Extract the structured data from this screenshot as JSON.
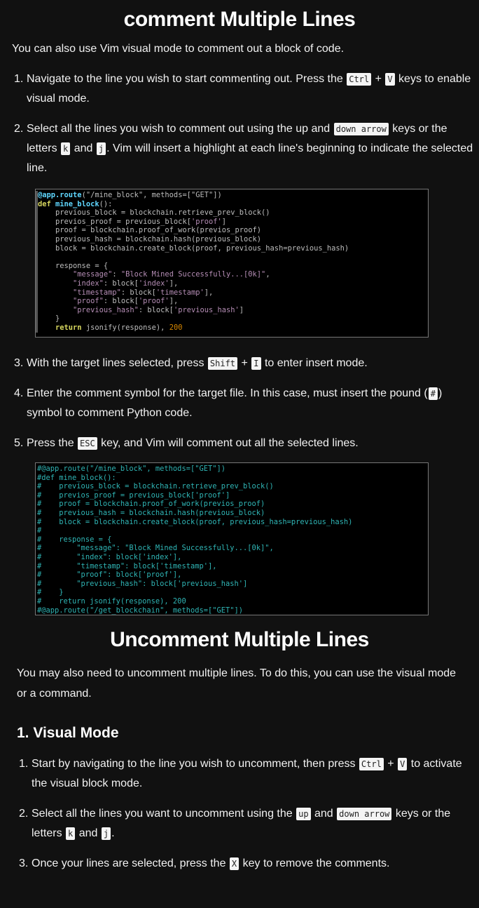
{
  "section1": {
    "title": "comment Multiple Lines",
    "intro": "You can also use Vim visual mode to comment out a block of code.",
    "steps_a": [
      [
        {
          "t": "Navigate to the line you wish to start commenting out. Press the "
        },
        {
          "k": "Ctrl"
        },
        {
          "t": " + "
        },
        {
          "k": "V"
        },
        {
          "t": " keys to enable visual mode."
        }
      ],
      [
        {
          "t": "Select all the lines you wish to comment out using the up and "
        },
        {
          "k": "down arrow"
        },
        {
          "t": " keys or the letters "
        },
        {
          "k": "k"
        },
        {
          "t": " and "
        },
        {
          "k": "j"
        },
        {
          "t": ". Vim will insert a highlight at each line's beginning to indicate the selected line."
        }
      ]
    ],
    "steps_b": [
      [
        {
          "t": "With the target lines selected, press "
        },
        {
          "k": "Shift"
        },
        {
          "t": " + "
        },
        {
          "k": "I"
        },
        {
          "t": " to enter insert mode."
        }
      ],
      [
        {
          "t": "Enter the comment symbol for the target file. In this case, must insert the pound ("
        },
        {
          "k": "#"
        },
        {
          "t": ") symbol to comment Python code."
        }
      ],
      [
        {
          "t": "Press the "
        },
        {
          "k": "ESC"
        },
        {
          "t": " key, and Vim will comment out all the selected lines."
        }
      ]
    ],
    "code_before": [
      [
        [
          "@app.route",
          "fn"
        ],
        [
          "(\"/mine_block\", methods=[\"GET\"])",
          "d"
        ]
      ],
      [
        [
          "def ",
          "kw"
        ],
        [
          "mine_block",
          "fn"
        ],
        [
          "():",
          "d"
        ]
      ],
      [
        [
          "    previous_block = blockchain.retrieve_prev_block()",
          "d"
        ]
      ],
      [
        [
          "    previos_proof = previous_block[",
          "d"
        ],
        [
          "'proof'",
          "st"
        ],
        [
          "]",
          "d"
        ]
      ],
      [
        [
          "    proof = blockchain.proof_of_work(previos_proof)",
          "d"
        ]
      ],
      [
        [
          "    previous_hash = blockchain.hash(previous_block)",
          "d"
        ]
      ],
      [
        [
          "    block = blockchain.create_block(proof, previous_hash=previous_hash)",
          "d"
        ]
      ],
      [
        [
          "",
          "d"
        ]
      ],
      [
        [
          "    response = {",
          "d"
        ]
      ],
      [
        [
          "        ",
          "d"
        ],
        [
          "\"message\"",
          "st"
        ],
        [
          ": ",
          "d"
        ],
        [
          "\"Block Mined Successfully...[0k]\"",
          "st"
        ],
        [
          ",",
          "d"
        ]
      ],
      [
        [
          "        ",
          "d"
        ],
        [
          "\"index\"",
          "st"
        ],
        [
          ": block[",
          "d"
        ],
        [
          "'index'",
          "st"
        ],
        [
          "],",
          "d"
        ]
      ],
      [
        [
          "        ",
          "d"
        ],
        [
          "\"timestamp\"",
          "st"
        ],
        [
          ": block[",
          "d"
        ],
        [
          "'timestamp'",
          "st"
        ],
        [
          "],",
          "d"
        ]
      ],
      [
        [
          "        ",
          "d"
        ],
        [
          "\"proof\"",
          "st"
        ],
        [
          ": block[",
          "d"
        ],
        [
          "'proof'",
          "st"
        ],
        [
          "],",
          "d"
        ]
      ],
      [
        [
          "        ",
          "d"
        ],
        [
          "\"previous_hash\"",
          "st"
        ],
        [
          ": block[",
          "d"
        ],
        [
          "'previous_hash'",
          "st"
        ],
        [
          "]",
          "d"
        ]
      ],
      [
        [
          "    }",
          "d"
        ]
      ],
      [
        [
          "    ",
          "d"
        ],
        [
          "return ",
          "kw"
        ],
        [
          "jsonify(response), ",
          "d"
        ],
        [
          "200",
          "nm"
        ]
      ]
    ],
    "code_after": [
      "#@app.route(\"/mine_block\", methods=[\"GET\"])",
      "#def mine_block():",
      "#    previous_block = blockchain.retrieve_prev_block()",
      "#    previos_proof = previous_block['proof']",
      "#    proof = blockchain.proof_of_work(previos_proof)",
      "#    previous_hash = blockchain.hash(previous_block)",
      "#    block = blockchain.create_block(proof, previous_hash=previous_hash)",
      "#",
      "#    response = {",
      "#        \"message\": \"Block Mined Successfully...[0k]\",",
      "#        \"index\": block['index'],",
      "#        \"timestamp\": block['timestamp'],",
      "#        \"proof\": block['proof'],",
      "#        \"previous_hash\": block['previous_hash']",
      "#    }",
      "#    return jsonify(response), 200",
      "#@app.route(\"/get_blockchain\", methods=[\"GET\"])"
    ]
  },
  "section2": {
    "title": "Uncomment Multiple Lines",
    "intro": "You may also need to uncomment multiple lines. To do this, you can use the visual mode or a command.",
    "subheading": "1. Visual Mode",
    "steps": [
      [
        {
          "t": "Start by navigating to the line you wish to uncomment, then press "
        },
        {
          "k": "Ctrl"
        },
        {
          "t": " + "
        },
        {
          "k": "V"
        },
        {
          "t": " to activate the visual block mode."
        }
      ],
      [
        {
          "t": "Select all the lines you want to uncomment using the "
        },
        {
          "k": "up"
        },
        {
          "t": " and "
        },
        {
          "k": "down arrow"
        },
        {
          "t": " keys or the letters "
        },
        {
          "k": "k"
        },
        {
          "t": " and "
        },
        {
          "k": "j"
        },
        {
          "t": "."
        }
      ],
      [
        {
          "t": "Once your lines are selected, press the "
        },
        {
          "k": "X"
        },
        {
          "t": " key to remove the comments."
        }
      ]
    ]
  }
}
